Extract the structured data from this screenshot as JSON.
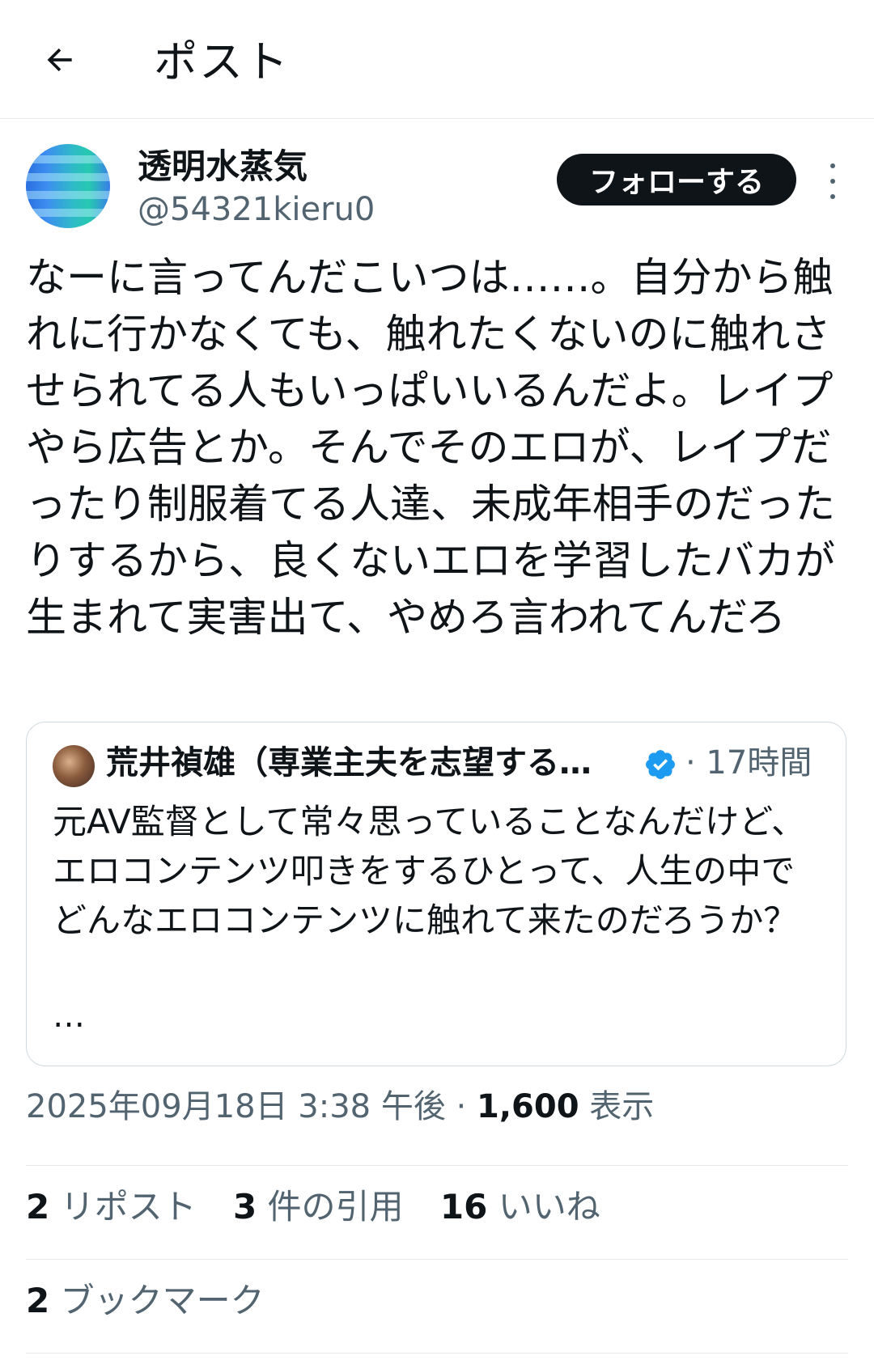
{
  "header": {
    "title": "ポスト"
  },
  "post": {
    "author": {
      "display_name": "透明水蒸気",
      "handle": "@54321kieru0"
    },
    "follow_label": "フォローする",
    "text": "なーに言ってんだこいつは……。自分から触れに行かなくても、触れたくないのに触れさせられてる人もいっぱいいるんだよ。レイプやら広告とか。そんでそのエロが、レイプだったり制服着てる人達、未成年相手のだったりするから、良くないエロを学習したバカが生まれて実害出て、やめろ言われてんだろ",
    "quote": {
      "display_name": "荒井禎雄（専業主夫を志望する…",
      "time": "· 17時間",
      "text": "元AV監督として常々思っていることなんだけど、エロコンテンツ叩きをするひとって、人生の中でどんなエロコンテンツに触れて来たのだろうか？",
      "ellipsis": "…"
    },
    "timestamp": "2025年09月18日 3:38 午後 · ",
    "views_count": "1,600",
    "views_label": " 表示",
    "stats": {
      "reposts_count": "2",
      "reposts_label": " リポスト",
      "quotes_count": "3",
      "quotes_label": " 件の引用",
      "likes_count": "16",
      "likes_label": " いいね",
      "bookmarks_count": "2",
      "bookmarks_label": " ブックマーク"
    }
  },
  "colors": {
    "text_primary": "#0f1419",
    "text_secondary": "#536471",
    "verified_blue": "#1d9bf0",
    "follow_button_bg": "#0f1419"
  }
}
